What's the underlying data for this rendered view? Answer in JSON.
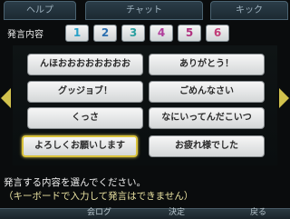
{
  "tabs": {
    "help": "ヘルプ",
    "chat": "チャット",
    "kick": "キック"
  },
  "speech": {
    "label": "発言内容",
    "numbers": [
      {
        "text": "1",
        "color": "#27a0c7"
      },
      {
        "text": "2",
        "color": "#2b6fb0"
      },
      {
        "text": "3",
        "color": "#2aa0a0"
      },
      {
        "text": "4",
        "color": "#b03c9b"
      },
      {
        "text": "5",
        "color": "#b0307f"
      },
      {
        "text": "6",
        "color": "#c23d78"
      }
    ]
  },
  "phrases": [
    "んほおおおおおおおお",
    "ありがとう！",
    "グッジョブ！",
    "ごめんなさい",
    "くっさ",
    "なにいってんだこいつ",
    "よろしくお願いします",
    "お疲れ様でした"
  ],
  "message": {
    "line1": "発言する内容を選んでください。",
    "line2": "（キーボードで入力して発言はできません）"
  },
  "bottom": {
    "log": "会ログ",
    "decide": "決定",
    "back": "戻る"
  }
}
